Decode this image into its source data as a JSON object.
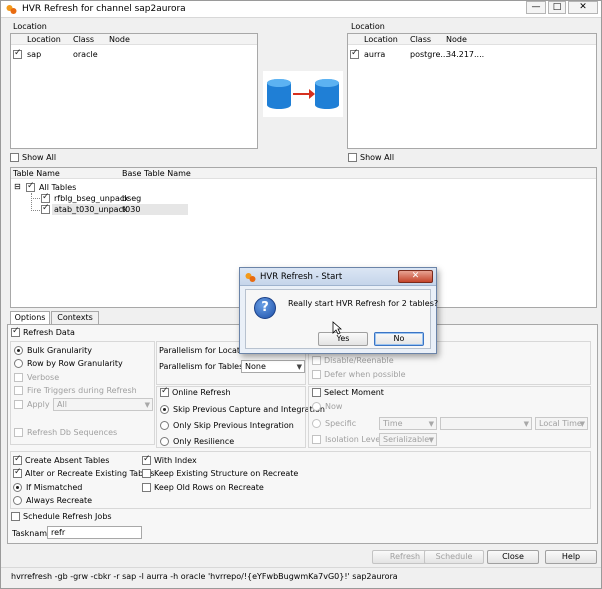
{
  "window": {
    "title": "HVR Refresh for channel sap2aurora",
    "minimize_glyph": "—",
    "maximize_glyph": "□",
    "close_glyph": "✕"
  },
  "left_location": {
    "section_label": "Location",
    "columns": [
      "Location",
      "Class",
      "Node"
    ],
    "rows": [
      {
        "location": "sap",
        "class": "oracle",
        "node": ""
      }
    ],
    "show_all_label": "Show All"
  },
  "right_location": {
    "section_label": "Location",
    "columns": [
      "Location",
      "Class",
      "Node"
    ],
    "rows": [
      {
        "location": "aurra",
        "class": "postgre...",
        "node": "34.217...."
      }
    ],
    "show_all_label": "Show All"
  },
  "tables": {
    "columns": [
      "Table Name",
      "Base Table Name"
    ],
    "root_label": "All Tables",
    "rows": [
      {
        "name": "rfblg_bseg_unpack",
        "base": "bseg"
      },
      {
        "name": "atab_t030_unpack",
        "base": "t030"
      }
    ]
  },
  "tabs": [
    "Options",
    "Contexts"
  ],
  "options": {
    "refresh_data": "Refresh Data",
    "bulk_granularity": "Bulk Granularity",
    "row_by_row": "Row by Row Granularity",
    "verbose": "Verbose",
    "fire_triggers": "Fire Triggers during Refresh",
    "apply": "Apply",
    "apply_value": "All",
    "refresh_db_sequences": "Refresh Db Sequences",
    "parallelism_locations": "Parallelism for Locations",
    "parallelism_tables": "Parallelism for Tables",
    "parallelism_tables_value": "None",
    "disable_reenable": "Disable/Reenable",
    "defer_when_possible": "Defer when possible",
    "online_refresh": "Online Refresh",
    "skip_previous_capture": "Skip Previous Capture and Integration",
    "only_skip_previous": "Only Skip Previous Integration",
    "only_resilience": "Only Resilience",
    "select_moment": "Select Moment",
    "now": "Now",
    "specific": "Specific",
    "specific_value": "Time",
    "local_time": "Local Time",
    "isolation_level": "Isolation Level",
    "isolation_value": "Serializable",
    "create_absent_tables": "Create Absent Tables",
    "with_index": "With Index",
    "alter_or_recreate": "Alter or Recreate Existing Tables",
    "keep_existing_structure": "Keep Existing Structure on Recreate",
    "if_mismatched": "If Mismatched",
    "keep_old_rows": "Keep Old Rows on Recreate",
    "always_recreate": "Always Recreate",
    "schedule_refresh_jobs": "Schedule Refresh Jobs",
    "taskname_label": "Taskname",
    "taskname_value": "refr"
  },
  "buttons": {
    "refresh": "Refresh",
    "schedule": "Schedule",
    "close": "Close",
    "help": "Help"
  },
  "status_command": "hvrrefresh -gb -grw -cbkr -r sap -l aurra -h oracle 'hvrrepo/!{eYFwbBugwmKa7vG0}!' sap2aurora",
  "dialog": {
    "title": "HVR Refresh - Start",
    "message": "Really start HVR Refresh for 2 tables?",
    "yes": "Yes",
    "no": "No",
    "question_glyph": "?",
    "close_glyph": "✕"
  },
  "colors": {
    "accent": "#3a74c4",
    "db_blue": "#1f7fd6",
    "arrow_red": "#d6301f",
    "dialog_close": "#c4452c"
  }
}
